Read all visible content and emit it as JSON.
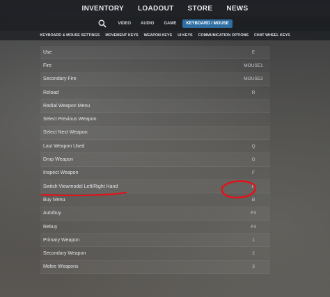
{
  "main_nav": [
    "INVENTORY",
    "LOADOUT",
    "STORE",
    "NEWS"
  ],
  "sub_tabs": [
    {
      "label": "VIDEO",
      "active": false
    },
    {
      "label": "AUDIO",
      "active": false
    },
    {
      "label": "GAME",
      "active": false
    },
    {
      "label": "KEYBOARD / MOUSE",
      "active": true
    }
  ],
  "categories": [
    "KEYBOARD & MOUSE SETTINGS",
    "MOVEMENT KEYS",
    "WEAPON KEYS",
    "UI KEYS",
    "COMMUNICATION OPTIONS",
    "CHAT WHEEL KEYS"
  ],
  "bindings": [
    {
      "action": "Use",
      "key": "E"
    },
    {
      "action": "Fire",
      "key": "MOUSE1"
    },
    {
      "action": "Secondary Fire",
      "key": "MOUSE2"
    },
    {
      "action": "Reload",
      "key": "R"
    },
    {
      "action": "Radial Weapon Menu",
      "key": ""
    },
    {
      "action": "Select Previous Weapon",
      "key": ""
    },
    {
      "action": "Select Next Weapon",
      "key": ""
    },
    {
      "action": "Last Weapon Used",
      "key": "Q"
    },
    {
      "action": "Drop Weapon",
      "key": "G"
    },
    {
      "action": "Inspect Weapon",
      "key": "F"
    },
    {
      "action": "Switch Viewmodel Left/Right Hand",
      "key": "H"
    },
    {
      "action": "Buy Menu",
      "key": "B"
    },
    {
      "action": "Autobuy",
      "key": "F3"
    },
    {
      "action": "Rebuy",
      "key": "F4"
    },
    {
      "action": "Primary Weapon",
      "key": "1"
    },
    {
      "action": "Secondary Weapon",
      "key": "2"
    },
    {
      "action": "Melee Weapons",
      "key": "3"
    }
  ],
  "colors": {
    "active_tab": "#2f6fa3",
    "annotation": "#e0141b"
  }
}
